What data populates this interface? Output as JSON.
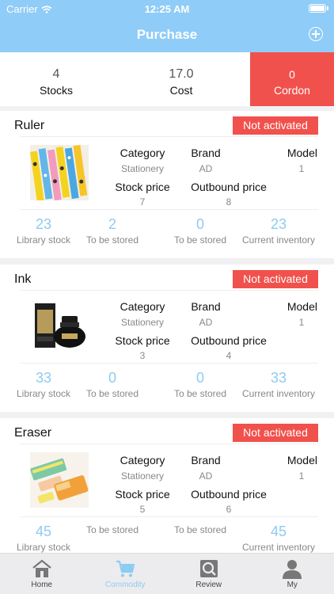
{
  "status_bar": {
    "carrier": "Carrier",
    "time": "12:25 AM"
  },
  "header": {
    "title": "Purchase"
  },
  "summary": [
    {
      "value": "4",
      "label": "Stocks"
    },
    {
      "value": "17.0",
      "label": "Cost"
    },
    {
      "value": "0",
      "label": "Cordon"
    }
  ],
  "labels": {
    "category": "Category",
    "brand": "Brand",
    "model": "Model",
    "stock_price": "Stock price",
    "outbound_price": "Outbound price",
    "library_stock": "Library stock",
    "to_be_stored": "To be stored",
    "current_inventory": "Current inventory"
  },
  "products": [
    {
      "name": "Ruler",
      "status": "Not activated",
      "category": "Stationery",
      "brand": "AD",
      "model": "1",
      "stock_price": "7",
      "outbound_price": "8",
      "library_stock": "23",
      "to_be_stored_1": "2",
      "to_be_stored_2": "0",
      "current_inventory": "23"
    },
    {
      "name": "Ink",
      "status": "Not activated",
      "category": "Stationery",
      "brand": "AD",
      "model": "1",
      "stock_price": "3",
      "outbound_price": "4",
      "library_stock": "33",
      "to_be_stored_1": "0",
      "to_be_stored_2": "0",
      "current_inventory": "33"
    },
    {
      "name": "Eraser",
      "status": "Not activated",
      "category": "Stationery",
      "brand": "AD",
      "model": "1",
      "stock_price": "5",
      "outbound_price": "6",
      "library_stock": "45",
      "to_be_stored_1": "",
      "to_be_stored_2": "",
      "current_inventory": "45"
    }
  ],
  "tabs": [
    {
      "label": "Home",
      "icon": "home-icon"
    },
    {
      "label": "Commodity",
      "icon": "cart-icon"
    },
    {
      "label": "Review",
      "icon": "review-icon"
    },
    {
      "label": "My",
      "icon": "user-icon"
    }
  ],
  "colors": {
    "header": "#8fccf7",
    "accent_red": "#f1514c",
    "stat_blue": "#8ecbf2"
  }
}
